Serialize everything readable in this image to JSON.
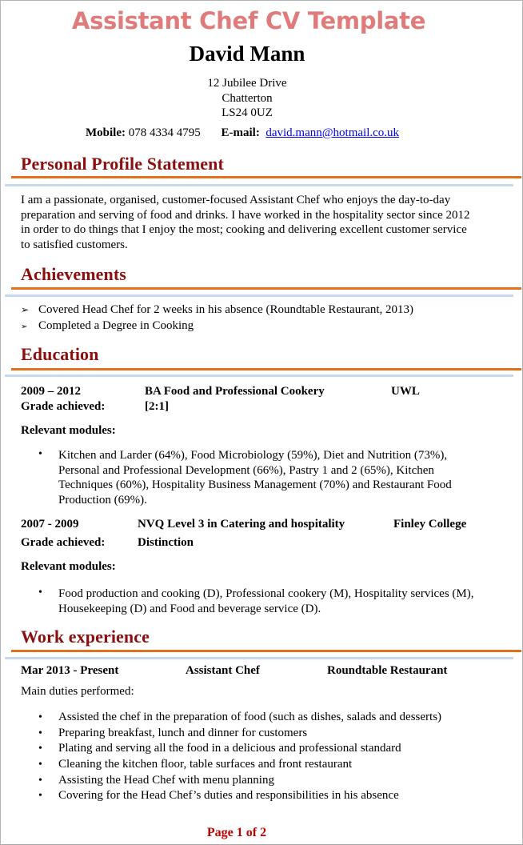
{
  "document": {
    "title": "Assistant Chef CV Template",
    "name": "David Mann",
    "address": [
      "12 Jubilee Drive",
      "Chatterton",
      "LS24 0UZ"
    ],
    "contact": {
      "mobile_label": "Mobile:",
      "mobile": "078 4334 4795",
      "email_label": "E-mail:",
      "email": "david.mann@hotmail.co.uk"
    },
    "colors": {
      "title": "#e07b7b",
      "heading": "#8b0f0f",
      "rule_orange": "#e2711d",
      "rule_blue": "#c6d9f0",
      "link": "#0000ee",
      "footer": "#c00000"
    }
  },
  "profile": {
    "heading": "Personal Profile Statement",
    "text": "I am a passionate, organised, customer-focused Assistant Chef who enjoys the day-to-day preparation and serving of food and drinks. I have worked in the hospitality sector since 2012 in order to do things that I enjoy the most; cooking and delivering excellent customer service to satisfied customers."
  },
  "achievements": {
    "heading": "Achievements",
    "bullet_icon": "arrowhead-bullet",
    "items": [
      "Covered Head Chef for 2 weeks in his absence (Roundtable Restaurant, 2013)",
      "Completed a Degree in Cooking"
    ]
  },
  "education": {
    "heading": "Education",
    "grade_label": "Grade achieved:",
    "modules_label": "Relevant modules:",
    "entries": [
      {
        "dates": "2009 – 2012",
        "qualification": "BA Food and Professional Cookery",
        "institution": "UWL",
        "grade": "[2:1]",
        "modules": "Kitchen and Larder (64%), Food Microbiology (59%), Diet and Nutrition (73%), Personal and Professional Development (66%), Pastry 1 and 2 (65%), Kitchen Techniques (60%), Hospitality Business Management (70%) and Restaurant Food Production (69%)."
      },
      {
        "dates": "2007 - 2009",
        "qualification": "NVQ Level 3 in Catering and hospitality",
        "institution": "Finley College",
        "grade": "Distinction",
        "modules": "Food production and cooking (D), Professional cookery (M), Hospitality services (M), Housekeeping (D) and Food and beverage service (D)."
      }
    ]
  },
  "work": {
    "heading": "Work experience",
    "jobs": [
      {
        "dates": "Mar 2013 - Present",
        "role": "Assistant Chef",
        "employer": "Roundtable Restaurant",
        "duties_label": "Main duties performed:",
        "duties": [
          "Assisted the chef in the preparation of food (such as dishes, salads and desserts)",
          "Preparing breakfast, lunch and dinner for customers",
          "Plating and serving all the food in a delicious and professional standard",
          "Cleaning the kitchen floor, table surfaces and front restaurant",
          "Assisting the Head Chef with menu planning",
          "Covering for the Head Chef’s duties and responsibilities in his absence"
        ]
      }
    ]
  },
  "footer": {
    "page_label": "Page 1 of 2"
  },
  "glyphs": {
    "arrow": "➢",
    "dot": "•"
  }
}
